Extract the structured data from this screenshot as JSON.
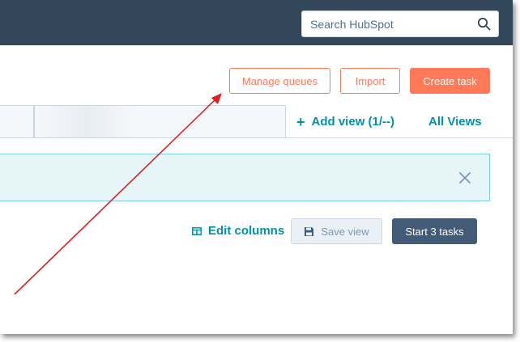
{
  "header": {
    "search": {
      "placeholder": "Search HubSpot",
      "icon": "search-icon"
    }
  },
  "actions": {
    "manage_queues": "Manage queues",
    "import": "Import",
    "create_task": "Create task"
  },
  "tabs": {
    "add_view": "Add view (1/--)",
    "all_views": "All Views"
  },
  "toolbar": {
    "edit_columns": "Edit columns",
    "save_view": "Save view",
    "start_tasks": "Start 3 tasks"
  },
  "colors": {
    "nav_bg": "#33475b",
    "accent_orange": "#ff7a59",
    "link_teal": "#0091ae",
    "banner_bg": "#e5f5f8",
    "start_button": "#425b76",
    "annotation_arrow": "#e02020"
  }
}
